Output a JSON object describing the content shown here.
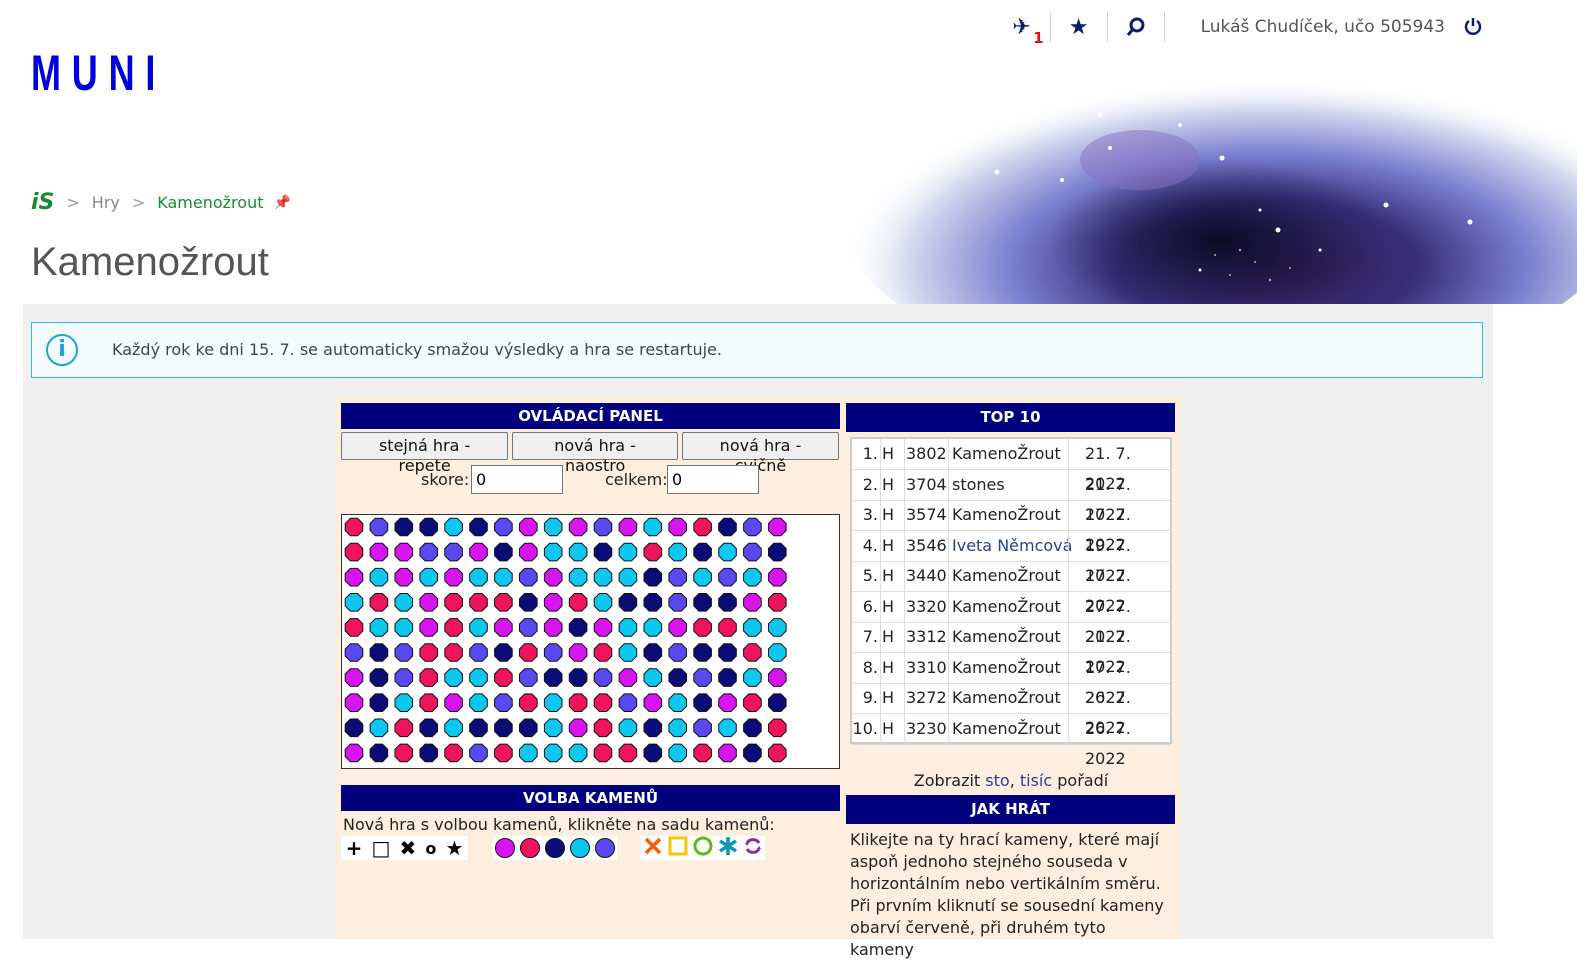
{
  "header": {
    "logo": "MUNI",
    "notification_count": "1",
    "user": "Lukáš Chudíček, učo 505943",
    "icons": [
      "plane-notification-icon",
      "star-icon",
      "search-icon",
      "power-icon"
    ]
  },
  "breadcrumb": {
    "root": "iS",
    "items": [
      "Hry",
      "Kamenožrout"
    ]
  },
  "page_title": "Kamenožrout",
  "info": {
    "text": "Každý rok ke dni 15. 7. se automaticky smažou výsledky a hra se restartuje."
  },
  "control_panel": {
    "title": "OVLÁDACÍ PANEL",
    "buttons": [
      "stejná hra - repete",
      "nová hra - naostro",
      "nová hra - cvičně"
    ],
    "score_label": "skore:",
    "score_value": "0",
    "total_label": "celkem:",
    "total_value": "0"
  },
  "board": {
    "colors": {
      "R": "#f0145c",
      "M": "#d814f0",
      "N": "#0c0c78",
      "C": "#0cc8f0",
      "B": "#5a48f0"
    },
    "rows": [
      "RBNNCNBMCMBMCMRNBM",
      "RMMBBMNMCCNCRCNCBN",
      "MCMCMCCBMCCCNBCBCM",
      "CRCMRRRNMRCNNBNNMR",
      "RCCMRCMBMNMCCMRRCC",
      "BNBRRBNRBMRCNBNNRC",
      "MNBRCCRBNNBMCNBNCM",
      "MNCRMCBRCRRBMCNMRN",
      "NCRNCNNNCMRCNCBCNR",
      "MNRNRBRCCCRRNCRMNR"
    ]
  },
  "top10": {
    "title": "TOP 10",
    "rows": [
      {
        "rank": "1.",
        "mode": "H",
        "score": "3802",
        "name": "KamenoŽrout",
        "date": "21. 7. 2022"
      },
      {
        "rank": "2.",
        "mode": "H",
        "score": "3704",
        "name": "stones",
        "date": "21. 7. 2022"
      },
      {
        "rank": "3.",
        "mode": "H",
        "score": "3574",
        "name": "KamenoŽrout",
        "date": "17. 7. 2022"
      },
      {
        "rank": "4.",
        "mode": "H",
        "score": "3546",
        "name": "Iveta Němcová",
        "date": "19. 7. 2022"
      },
      {
        "rank": "5.",
        "mode": "H",
        "score": "3440",
        "name": "KamenoŽrout",
        "date": "17. 7. 2022"
      },
      {
        "rank": "6.",
        "mode": "H",
        "score": "3320",
        "name": "KamenoŽrout",
        "date": "27. 7. 2022"
      },
      {
        "rank": "7.",
        "mode": "H",
        "score": "3312",
        "name": "KamenoŽrout",
        "date": "21. 7. 2022"
      },
      {
        "rank": "8.",
        "mode": "H",
        "score": "3310",
        "name": "KamenoŽrout",
        "date": "17. 7. 2022"
      },
      {
        "rank": "9.",
        "mode": "H",
        "score": "3272",
        "name": "KamenoŽrout",
        "date": "26. 7. 2022"
      },
      {
        "rank": "10.",
        "mode": "H",
        "score": "3230",
        "name": "KamenoŽrout",
        "date": "26. 7. 2022"
      }
    ],
    "show_prefix": "Zobrazit",
    "show_link1": "sto",
    "show_link2": "tisíc",
    "show_suffix": "pořadí"
  },
  "volba": {
    "title": "VOLBA KAMENŮ",
    "text": "Nová hra s volbou kamenů, klikněte na sadu kamenů:",
    "set1_symbols": [
      "+",
      "□",
      "✖",
      "o",
      "★"
    ],
    "set3_colors": [
      "#ff5a00",
      "#f0c800",
      "#64b41e",
      "#0a96b4",
      "#8c28a0"
    ]
  },
  "jak_hrat": {
    "title": "JAK HRÁT",
    "text": "Klikejte na ty hrací kameny, které mají aspoň jednoho stejného souseda v horizontálním nebo vertikálním směru. Při prvním kliknutí se sousední kameny obarví červeně, při druhém tyto kameny"
  }
}
